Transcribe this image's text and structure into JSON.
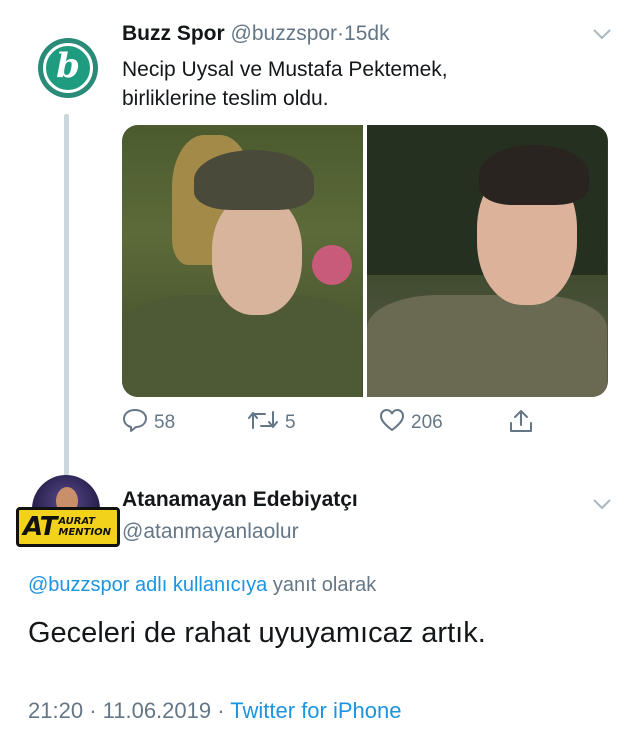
{
  "tweet": {
    "author_name": "Buzz Spor",
    "author_handle": "@buzzspor",
    "separator": "·",
    "time": "15dk",
    "avatar_letter": "b",
    "text_line1": "Necip Uysal ve Mustafa Pektemek,",
    "text_line2": "birliklerine teslim oldu.",
    "replies": "58",
    "retweets": "5",
    "likes": "206"
  },
  "reply": {
    "author_name": "Atanamayan Edebiyatçı",
    "author_handle": "@atanmayanlaolur",
    "avatar_logo_big": "AT",
    "avatar_logo_small1": "AURAT",
    "avatar_logo_small2": "MENTION",
    "replying_to_handle": "@buzzspor adlı kullanıcıya",
    "replying_suffix": "yanıt olarak",
    "text": "Geceleri de rahat uyuyamıcaz artık.",
    "time": "21:20",
    "dot": "·",
    "date": "11.06.2019",
    "dot2": "·",
    "source": "Twitter for iPhone"
  },
  "colors": {
    "accent": "#1b95e0",
    "muted": "#657786",
    "thread_line": "#ccd6dd",
    "avatar1_bg": "#1f9b80"
  },
  "icons": [
    "reply-icon",
    "retweet-icon",
    "like-icon",
    "share-icon",
    "chevron-down-icon"
  ]
}
